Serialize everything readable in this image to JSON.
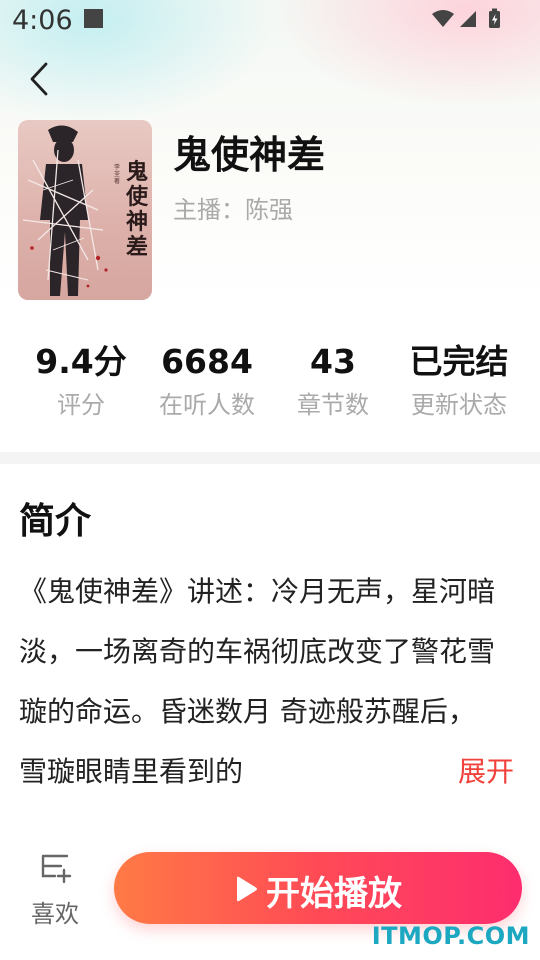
{
  "status_bar": {
    "time": "4:06"
  },
  "book": {
    "title": "鬼使神差",
    "narrator": "主播：陈强",
    "cover_title": "鬼使神差",
    "cover_author": "李荃著"
  },
  "stats": [
    {
      "value": "9.4分",
      "label": "评分"
    },
    {
      "value": "6684",
      "label": "在听人数"
    },
    {
      "value": "43",
      "label": "章节数"
    },
    {
      "value": "已完结",
      "label": "更新状态"
    }
  ],
  "intro": {
    "heading": "简介",
    "text": "《鬼使神差》讲述：冷月无声，星河暗淡，一场离奇的车祸彻底改变了警花雪璇的命运。昏迷数月 奇迹般苏醒后，雪璇眼睛里看到的",
    "expand_label": "展开"
  },
  "bottom_bar": {
    "like_label": "喜欢",
    "play_label": "开始播放"
  },
  "watermark": "ITMOP.COM",
  "colors": {
    "accent_red": "#f0413a",
    "play_gradient_start": "#ff7a45",
    "play_gradient_end": "#fe2d6f",
    "watermark": "#1ba8c0"
  }
}
